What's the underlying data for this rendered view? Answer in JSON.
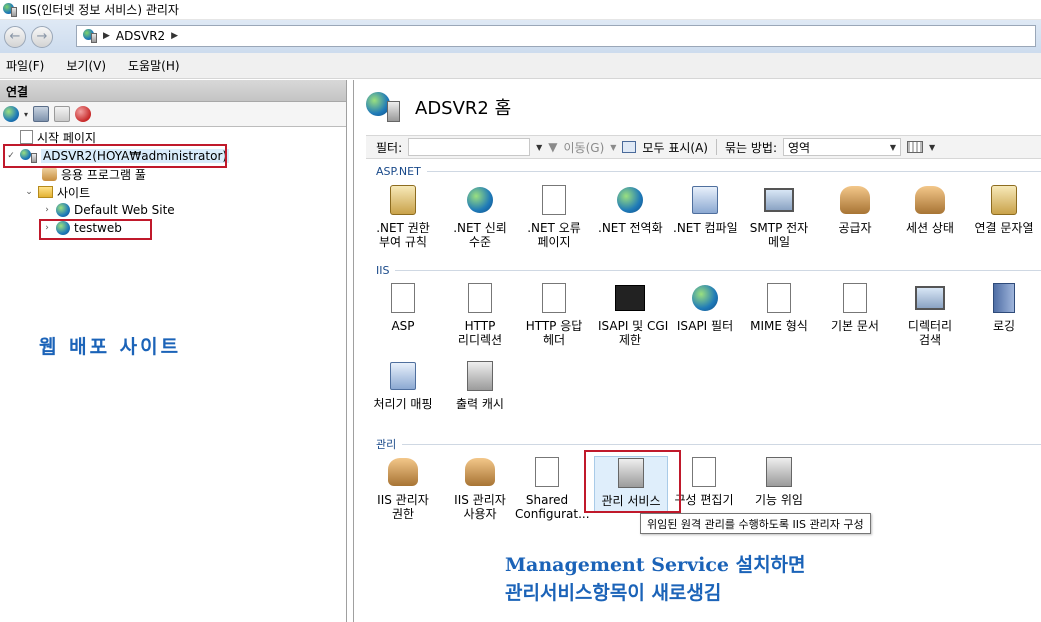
{
  "window": {
    "title": "IIS(인터넷 정보 서비스) 관리자"
  },
  "address": {
    "crumb": "ADSVR2"
  },
  "menu": [
    "파일(F)",
    "보기(V)",
    "도움말(H)"
  ],
  "left": {
    "header": "연결",
    "tree": {
      "start_page": "시작 페이지",
      "server": "ADSVR2(HOYA₩administrator)",
      "app_pools": "응용 프로그램 풀",
      "sites": "사이트",
      "default_site": "Default Web Site",
      "testweb": "testweb"
    },
    "annotation": "웹 배포 사이트"
  },
  "right": {
    "title": "ADSVR2 홈",
    "filter": {
      "label": "필터:",
      "go": "이동(G)",
      "show_all": "모두 표시(A)",
      "group_label": "묶는 방법:",
      "group_value": "영역"
    },
    "sections": {
      "aspnet": "ASP.NET",
      "iis": "IIS",
      "manage": "관리"
    },
    "aspnet_features": [
      {
        "l1": ".NET 권한",
        "l2": "부여 규칙"
      },
      {
        "l1": ".NET 신뢰",
        "l2": "수준"
      },
      {
        "l1": ".NET 오류",
        "l2": "페이지"
      },
      {
        "l1": ".NET 전역화",
        "l2": ""
      },
      {
        "l1": ".NET 컴파일",
        "l2": ""
      },
      {
        "l1": "SMTP 전자",
        "l2": "메일"
      },
      {
        "l1": "공급자",
        "l2": ""
      },
      {
        "l1": "세션 상태",
        "l2": ""
      },
      {
        "l1": "연결 문자열",
        "l2": ""
      }
    ],
    "iis_features": [
      {
        "l1": "ASP",
        "l2": ""
      },
      {
        "l1": "HTTP",
        "l2": "리디렉션"
      },
      {
        "l1": "HTTP 응답",
        "l2": "헤더"
      },
      {
        "l1": "ISAPI 및 CGI",
        "l2": "제한"
      },
      {
        "l1": "ISAPI 필터",
        "l2": ""
      },
      {
        "l1": "MIME 형식",
        "l2": ""
      },
      {
        "l1": "기본 문서",
        "l2": ""
      },
      {
        "l1": "디렉터리",
        "l2": "검색"
      },
      {
        "l1": "로깅",
        "l2": ""
      },
      {
        "l1": "처리기 매핑",
        "l2": ""
      },
      {
        "l1": "출력 캐시",
        "l2": ""
      }
    ],
    "manage_features": [
      {
        "l1": "IIS 관리자",
        "l2": "권한"
      },
      {
        "l1": "IIS 관리자",
        "l2": "사용자"
      },
      {
        "l1": "Shared",
        "l2": "Configurat..."
      },
      {
        "l1": "관리 서비스",
        "l2": ""
      },
      {
        "l1": "구성 편집기",
        "l2": ""
      },
      {
        "l1": "기능 위임",
        "l2": ""
      }
    ],
    "tooltip": "위임된 원격 관리를 수행하도록 IIS 관리자 구성",
    "annotation": {
      "line1": "Management Service 설치하면",
      "line2": "관리서비스항목이 새로생김"
    }
  },
  "colors": {
    "annotation": "#1b63b8",
    "highlight_box": "#c0192b",
    "selection": "#d9ecfb"
  }
}
